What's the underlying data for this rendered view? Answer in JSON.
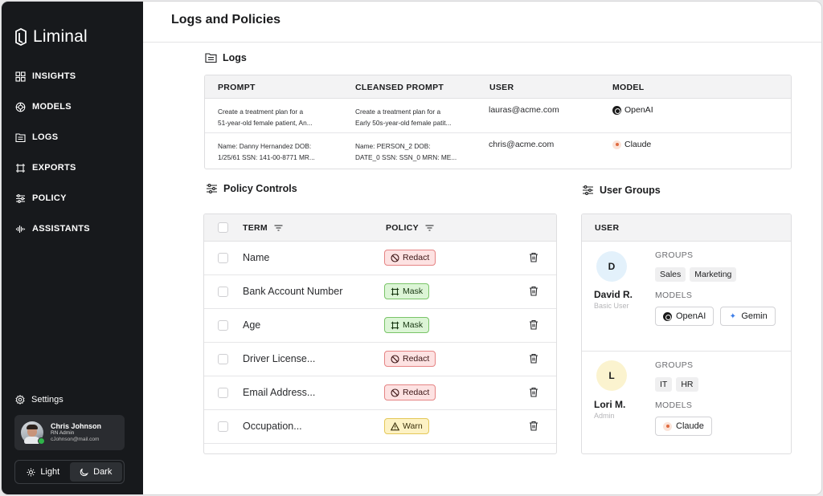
{
  "app": {
    "name": "Liminal"
  },
  "sidebar": {
    "items": [
      {
        "label": "INSIGHTS",
        "icon": "grid-icon"
      },
      {
        "label": "MODELS",
        "icon": "model-icon"
      },
      {
        "label": "LOGS",
        "icon": "logs-icon"
      },
      {
        "label": "EXPORTS",
        "icon": "exports-icon"
      },
      {
        "label": "POLICY",
        "icon": "sliders-icon"
      },
      {
        "label": "ASSISTANTS",
        "icon": "waveform-icon"
      }
    ],
    "settings_label": "Settings",
    "user": {
      "name": "Chris Johnson",
      "role": "RN Admin",
      "email": "cJohnson@mail.com"
    },
    "theme": {
      "light_label": "Light",
      "dark_label": "Dark",
      "active": "Dark"
    }
  },
  "header": {
    "title": "Logs and Policies"
  },
  "logs": {
    "title": "Logs",
    "columns": [
      "PROMPT",
      "CLEANSED PROMPT",
      "USER",
      "MODEL"
    ],
    "rows": [
      {
        "prompt_line1": "Create a treatment plan for a",
        "prompt_line2": "51-year-old female patient, An...",
        "cleansed_line1": "Create a treatment plan for a",
        "cleansed_line2": "Early 50s-year-old female patit...",
        "user": "lauras@acme.com",
        "model": "OpenAI"
      },
      {
        "prompt_line1": "Name: Danny Hernandez DOB:",
        "prompt_line2": "1/25/61 SSN: 141-00-8771 MR...",
        "cleansed_line1": "Name: PERSON_2 DOB:",
        "cleansed_line2": "DATE_0 SSN: SSN_0 MRN: ME...",
        "user": "chris@acme.com",
        "model": "Claude"
      }
    ]
  },
  "policy": {
    "title": "Policy Controls",
    "columns": {
      "term": "TERM",
      "policy": "POLICY"
    },
    "rows": [
      {
        "term": "Name",
        "policy": "Redact"
      },
      {
        "term": "Bank Account Number",
        "policy": "Mask"
      },
      {
        "term": "Age",
        "policy": "Mask"
      },
      {
        "term": "Driver License...",
        "policy": "Redact"
      },
      {
        "term": "Email Address...",
        "policy": "Redact"
      },
      {
        "term": "Occupation...",
        "policy": "Warn"
      }
    ],
    "colors": {
      "redact": "#fde2e2",
      "mask": "#dcf5d6",
      "warn": "#fdf2c4"
    }
  },
  "user_groups": {
    "title": "User Groups",
    "column": "USER",
    "groups_label": "GROUPS",
    "models_label": "MODELS",
    "users": [
      {
        "initial": "D",
        "name": "David R.",
        "role": "Basic User",
        "avatar_color": "#e3f1fb",
        "groups": [
          "Sales",
          "Marketing"
        ],
        "models": [
          "OpenAI",
          "Gemin"
        ]
      },
      {
        "initial": "L",
        "name": "Lori M.",
        "role": "Admin",
        "avatar_color": "#fbf3cf",
        "groups": [
          "IT",
          "HR"
        ],
        "models": [
          "Claude"
        ]
      }
    ]
  }
}
